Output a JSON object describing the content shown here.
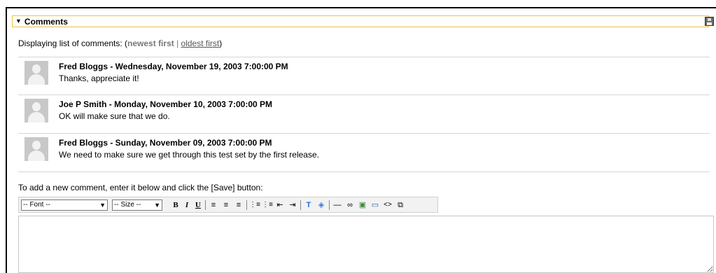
{
  "panel": {
    "title": "Comments",
    "collapse_icon": "triangle-down-icon",
    "save_icon": "floppy-disk-icon"
  },
  "list_header": {
    "prefix": "Displaying list of comments: (",
    "newest": "newest first",
    "sep": " | ",
    "oldest": "oldest first",
    "suffix": ")"
  },
  "comments": [
    {
      "meta": "Fred Bloggs - Wednesday, November 19, 2003 7:00:00 PM",
      "text": "Thanks, appreciate it!"
    },
    {
      "meta": "Joe P Smith - Monday, November 10, 2003 7:00:00 PM",
      "text": "OK will make sure that we do."
    },
    {
      "meta": "Fred Bloggs - Sunday, November 09, 2003 7:00:00 PM",
      "text": "We need to make sure we get through this test set by the first release."
    }
  ],
  "instructions": "To add a new comment, enter it below and click the [Save] button:",
  "toolbar": {
    "font_select": "-- Font --",
    "size_select": "-- Size --",
    "bold": "B",
    "italic": "I",
    "underline": "U",
    "align_left": "≡",
    "align_center": "≡",
    "align_right": "≡",
    "ordered_list": "⋮≡",
    "unordered_list": "⋮≡",
    "outdent": "⇤",
    "indent": "⇥",
    "text_color": "T",
    "highlight": "◈",
    "hr": "—",
    "link": "∞",
    "image": "▣",
    "table": "▭",
    "source": "<>",
    "fullscreen": "⧉"
  },
  "editor": {
    "value": ""
  }
}
